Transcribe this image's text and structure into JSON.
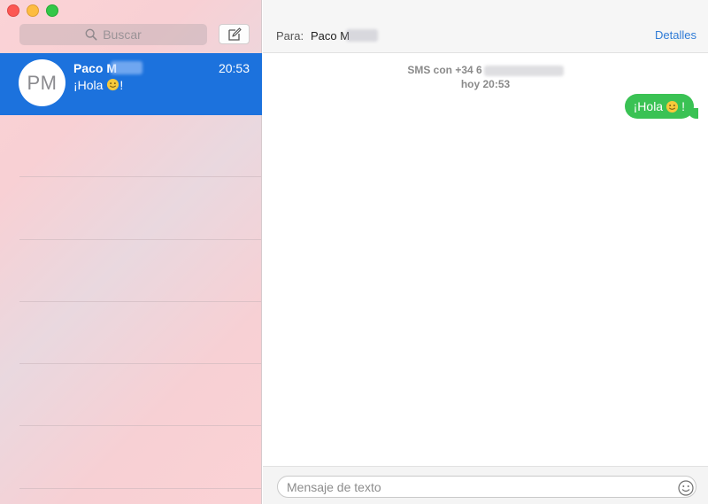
{
  "sidebar": {
    "search_placeholder": "Buscar",
    "conversations": [
      {
        "initials": "PM",
        "name": "Paco M",
        "time": "20:53",
        "preview_before": "¡Hola ",
        "preview_after": "!",
        "preview_emoji": "smile-icon"
      }
    ]
  },
  "header": {
    "to_label": "Para:",
    "recipient": "Paco M",
    "details_label": "Detalles"
  },
  "thread": {
    "meta_line1": "SMS con +34 6",
    "meta_line2": "hoy 20:53",
    "messages": [
      {
        "text_before": "¡Hola ",
        "text_after": " !",
        "emoji": "smile-icon",
        "direction": "outgoing"
      }
    ]
  },
  "composer": {
    "placeholder": "Mensaje de texto",
    "emoji_button_icon": "emoji-picker-icon"
  },
  "colors": {
    "selection": "#1c72dd",
    "bubble": "#3ac254",
    "link": "#2f7bd6"
  }
}
